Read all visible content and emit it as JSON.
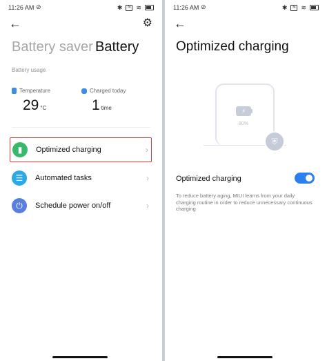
{
  "status_bar": {
    "time": "11:26 AM",
    "mute_glyph": "⊘",
    "bluetooth_glyph": "✱",
    "nfc_glyph": "N",
    "wifi_glyph": "≋"
  },
  "left_screen": {
    "tabs": [
      "Battery saver",
      "Battery"
    ],
    "section_label": "Battery usage",
    "temperature": {
      "label": "Temperature",
      "value": "29",
      "unit": "°C"
    },
    "charged_today": {
      "label": "Charged today",
      "value": "1",
      "unit": "time"
    },
    "menu": [
      {
        "label": "Optimized charging",
        "icon": "battery-doc-icon",
        "glyph": "▮"
      },
      {
        "label": "Automated tasks",
        "icon": "clipboard-icon",
        "glyph": "☰"
      },
      {
        "label": "Schedule power on/off",
        "icon": "power-icon",
        "glyph": "⏻"
      }
    ],
    "chevron_glyph": "›"
  },
  "right_screen": {
    "title": "Optimized charging",
    "illustration": {
      "percent_text": "80%",
      "bolt_glyph": "⚡",
      "shield_glyph": "⛨"
    },
    "toggle": {
      "label": "Optimized charging",
      "state": "on"
    },
    "description": "To reduce battery aging, MIUI learns from your daily charging routine in order to reduce unnecessary continuous charging"
  },
  "colors": {
    "accent": "#2b7fee",
    "highlight_box": "#d93a3a",
    "icon_green": "#38b86b",
    "icon_blue": "#2aa8e8",
    "icon_indigo": "#5b7fe1"
  },
  "icons": {
    "back": "←",
    "settings": "⚙"
  }
}
